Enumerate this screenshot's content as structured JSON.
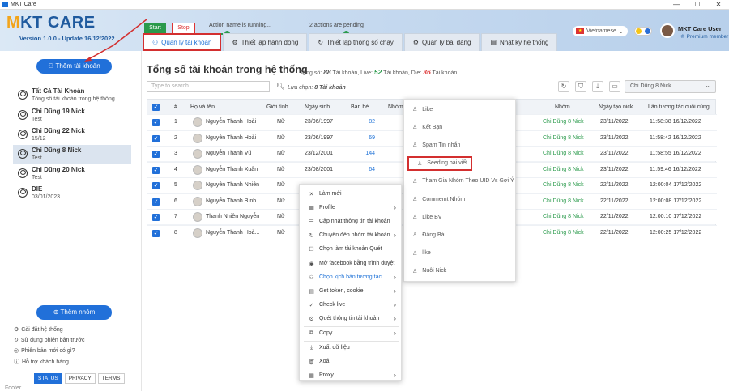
{
  "window": {
    "title": "MKT Care",
    "controls": [
      "—",
      "☐",
      "✕"
    ]
  },
  "header": {
    "logo_m": "M",
    "logo_rest": "KT CARE",
    "version": "Version 1.0.0 - Update 16/12/2022",
    "start": "Start",
    "stop": "Stop",
    "action_label": "Action name is running...",
    "pending_label": "2 actions are pending",
    "action_progress": 0.2,
    "pending_progress": 0.4,
    "language": "Vietnamese",
    "user_name": "MKT Care User",
    "user_tier": "♔ Premium member"
  },
  "tabs": [
    {
      "label": "Quản lý tài khoản",
      "icon": "⚇",
      "active": true
    },
    {
      "label": "Thiết lập hành động",
      "icon": "⚙"
    },
    {
      "label": "Thiết lập thông số chạy",
      "icon": "↻"
    },
    {
      "label": "Quản lý bài đăng",
      "icon": "⚙"
    },
    {
      "label": "Nhật ký hệ thống",
      "icon": "▤"
    }
  ],
  "sidebar": {
    "add_account": "⚇ Thêm tài khoản",
    "accounts": [
      {
        "name": "Tất Cả Tài Khoản",
        "sub": "Tổng số tài khoản trong hệ thống"
      },
      {
        "name": "Chi Dũng 19 Nick",
        "sub": "Test"
      },
      {
        "name": "Chi Dũng 22 Nick",
        "sub": "15/12"
      },
      {
        "name": "Chi Dũng 8 Nick",
        "sub": "Test"
      },
      {
        "name": "Chi Dũng 20 Nick",
        "sub": "Test"
      },
      {
        "name": "DIE",
        "sub": "03/01/2023"
      }
    ],
    "add_group": "⊕ Thêm nhóm",
    "links": [
      {
        "icon": "⚙",
        "label": "Cài đặt hệ thống"
      },
      {
        "icon": "↻",
        "label": "Sử dụng phiên bản trước"
      },
      {
        "icon": "◎",
        "label": "Phiên bản mới có gì?"
      },
      {
        "icon": "ⓘ",
        "label": "Hỗ trợ khách hàng"
      }
    ],
    "footer_buttons": [
      "STATUS",
      "PRIVACY",
      "TERMS"
    ],
    "footer_text": "Footer"
  },
  "main": {
    "title": "Tổng số tài khoản trong hệ thống",
    "summary_total_label": "Tổng số:",
    "summary_total": "88",
    "summary_total_unit": "Tài khoản,  Live:",
    "summary_live": "52",
    "summary_live_unit": "Tài khoản,  Die:",
    "summary_die": "36",
    "summary_die_unit": "Tài khoản",
    "search_placeholder": "Type to search...",
    "select_label": "Lựa chọn:",
    "select_value": "8 Tài khoản",
    "group_select": "Chi Dũng 8 Nick",
    "tool_icons": [
      "↻",
      "⛉",
      "⤓",
      "▭"
    ]
  },
  "table": {
    "headers": [
      "#",
      "Họ và tên",
      "Giới tính",
      "Ngày sinh",
      "Bạn bè",
      "Nhóm",
      "Nhóm",
      "Ngày tạo nick",
      "Lần tương tác cuối cùng"
    ],
    "rows": [
      {
        "n": "1",
        "name": "Nguyễn Thanh Hoài",
        "sex": "Nữ",
        "dob": "23/06/1997",
        "friends": "82",
        "group": "Chi Dũng 8 Nick",
        "created": "23/11/2022",
        "last": "11:58:38 16/12/2022"
      },
      {
        "n": "2",
        "name": "Nguyễn Thanh Hoài",
        "sex": "Nữ",
        "dob": "23/06/1997",
        "friends": "69",
        "group": "Chi Dũng 8 Nick",
        "created": "23/11/2022",
        "last": "11:58:42 16/12/2022"
      },
      {
        "n": "3",
        "name": "Nguyễn Thanh Vũ",
        "sex": "Nữ",
        "dob": "23/12/2001",
        "friends": "144",
        "group": "Chi Dũng 8 Nick",
        "created": "23/11/2022",
        "last": "11:58:55 16/12/2022"
      },
      {
        "n": "4",
        "name": "Nguyễn Thanh Xuân",
        "sex": "Nữ",
        "dob": "23/08/2001",
        "friends": "64",
        "group": "Chi Dũng 8 Nick",
        "created": "23/11/2022",
        "last": "11:59:46 16/12/2022"
      },
      {
        "n": "5",
        "name": "Nguyễn Thanh Nhiên",
        "sex": "Nữ",
        "dob": "",
        "friends": "",
        "group": "Chi Dũng 8 Nick",
        "created": "22/11/2022",
        "last": "12:00:04 17/12/2022"
      },
      {
        "n": "6",
        "name": "Nguyễn Thanh Bình",
        "sex": "Nữ",
        "dob": "",
        "friends": "",
        "group": "Chi Dũng 8 Nick",
        "created": "22/11/2022",
        "last": "12:00:08 17/12/2022"
      },
      {
        "n": "7",
        "name": "Thanh Nhiên Nguyễn",
        "sex": "Nữ",
        "dob": "",
        "friends": "",
        "group": "Chi Dũng 8 Nick",
        "created": "22/11/2022",
        "last": "12:00:10 17/12/2022"
      },
      {
        "n": "8",
        "name": "Nguyễn Thanh Hoà...",
        "sex": "Nữ",
        "dob": "",
        "friends": "",
        "group": "Chi Dũng 8 Nick",
        "created": "22/11/2022",
        "last": "12:00:25 17/12/2022"
      }
    ]
  },
  "context_menu": [
    {
      "icon": "✕",
      "label": "Làm mới"
    },
    {
      "icon": "▦",
      "label": "Profile",
      "sub": true
    },
    {
      "icon": "☰",
      "label": "Cập nhật thông tin tài khoản"
    },
    {
      "icon": "↻",
      "label": "Chuyển đến nhóm tài khoản",
      "sub": true
    },
    {
      "icon": "☐",
      "label": "Chọn làm tài khoản Quét"
    },
    {
      "icon": "◉",
      "label": "Mở facebook bằng trình duyệt"
    },
    {
      "icon": "⚇",
      "label": "Chọn kịch bản tương tác",
      "sub": true,
      "blue": true
    },
    {
      "icon": "▤",
      "label": "Get token, cookie",
      "sub": true
    },
    {
      "icon": "✓",
      "label": "Check live",
      "sub": true
    },
    {
      "icon": "⚙",
      "label": "Quét thông tin tài khoản",
      "sub": true
    },
    {
      "icon": "⧉",
      "label": "Copy",
      "sub": true
    },
    {
      "icon": "⤓",
      "label": "Xuất dữ liệu"
    },
    {
      "icon": "🗑",
      "label": "Xoá"
    },
    {
      "icon": "▦",
      "label": "Proxy",
      "sub": true
    }
  ],
  "submenu": [
    "Like",
    "Kết Bạn",
    "Spam Tin nhắn",
    "Seeding bài viết",
    "Tham Gia Nhóm Theo UID Vs Gợi Ý",
    "Commemt Nhóm",
    "Like BV",
    "Đăng Bài",
    "like",
    "Nuôi Nick"
  ],
  "submenu_highlight": 3
}
